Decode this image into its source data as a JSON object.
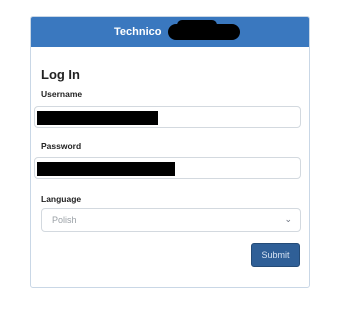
{
  "header": {
    "title": "Technico"
  },
  "form": {
    "heading": "Log In",
    "username_label": "Username",
    "password_label": "Password",
    "language_label": "Language",
    "language_value": "Polish",
    "submit_label": "Submit"
  },
  "colors": {
    "header_bg": "#3a78bf",
    "button_bg": "#2f5f97",
    "redaction": "#000000"
  }
}
